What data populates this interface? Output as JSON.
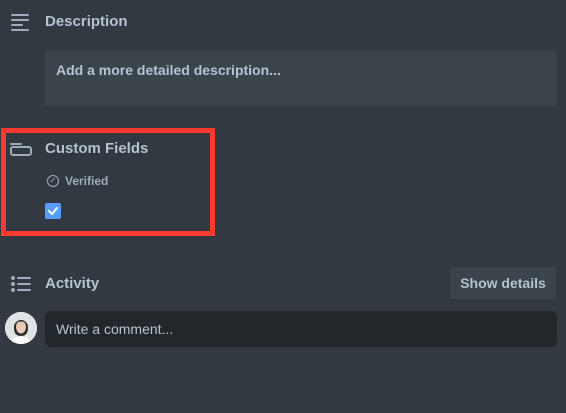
{
  "description": {
    "title": "Description",
    "placeholder": "Add a more detailed description..."
  },
  "custom_fields": {
    "title": "Custom Fields",
    "field_label": "Verified",
    "field_checked": true
  },
  "activity": {
    "title": "Activity",
    "show_details_label": "Show details",
    "comment_placeholder": "Write a comment..."
  },
  "colors": {
    "background": "#323940",
    "accent": "#579dff",
    "highlight": "#ff3b30"
  }
}
